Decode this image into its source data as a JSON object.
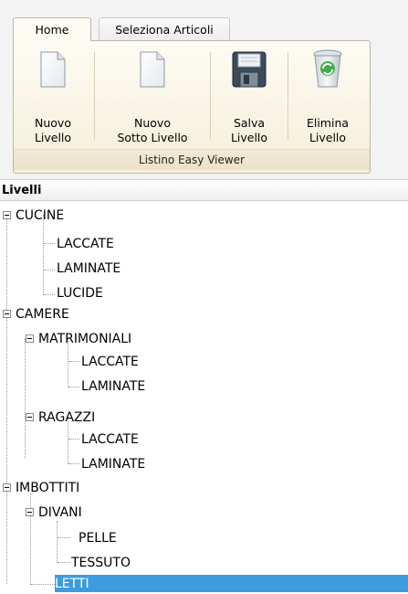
{
  "tabs": [
    {
      "label": "Home"
    },
    {
      "label": "Seleziona Articoli"
    }
  ],
  "ribbon": {
    "buttons": [
      {
        "label_line1": "Nuovo",
        "label_line2": "Livello",
        "icon": "blank-page-icon"
      },
      {
        "label_line1": "Nuovo",
        "label_line2": "Sotto Livello",
        "icon": "blank-page-icon"
      },
      {
        "label_line1": "Salva",
        "label_line2": "Livello",
        "icon": "floppy-disk-icon"
      },
      {
        "label_line1": "Elimina",
        "label_line2": "Livello",
        "icon": "recycle-bin-icon"
      }
    ],
    "group_label": "Listino Easy Viewer"
  },
  "tree": {
    "header": "Livelli",
    "nodes": [
      {
        "label": "CUCINE",
        "expanded": true
      },
      {
        "label": "LACCATE"
      },
      {
        "label": "LAMINATE"
      },
      {
        "label": "LUCIDE"
      },
      {
        "label": "CAMERE",
        "expanded": true
      },
      {
        "label": "MATRIMONIALI",
        "expanded": true
      },
      {
        "label": "LACCATE"
      },
      {
        "label": "LAMINATE"
      },
      {
        "label": "RAGAZZI",
        "expanded": true
      },
      {
        "label": "LACCATE"
      },
      {
        "label": "LAMINATE"
      },
      {
        "label": "IMBOTTITI",
        "expanded": true
      },
      {
        "label": "DIVANI",
        "expanded": true
      },
      {
        "label": "PELLE"
      },
      {
        "label": "TESSUTO"
      },
      {
        "label": "LETTI",
        "selected": true
      }
    ]
  },
  "colors": {
    "selection": "#3d9cde",
    "ribbon_panel": "#f5eed8"
  }
}
